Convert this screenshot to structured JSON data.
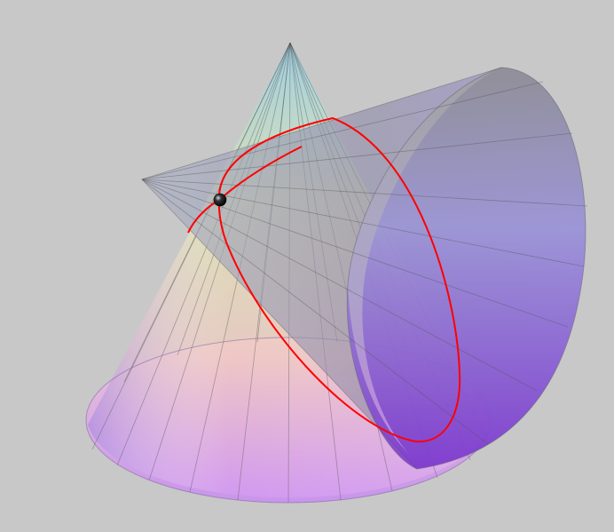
{
  "scene": {
    "background_color": "#c8c8c8",
    "surfaces": [
      {
        "name": "vertical-cone",
        "color_top": "#8fd0e8",
        "color_bottom": "#e6a0f4"
      },
      {
        "name": "horizontal-cone",
        "color_left": "#9aa6c4",
        "color_right": "#7a3fd0"
      }
    ],
    "intersection_curve_color": "#ff0000",
    "marker_color": "#111111",
    "mesh_line_color": "#555555"
  }
}
